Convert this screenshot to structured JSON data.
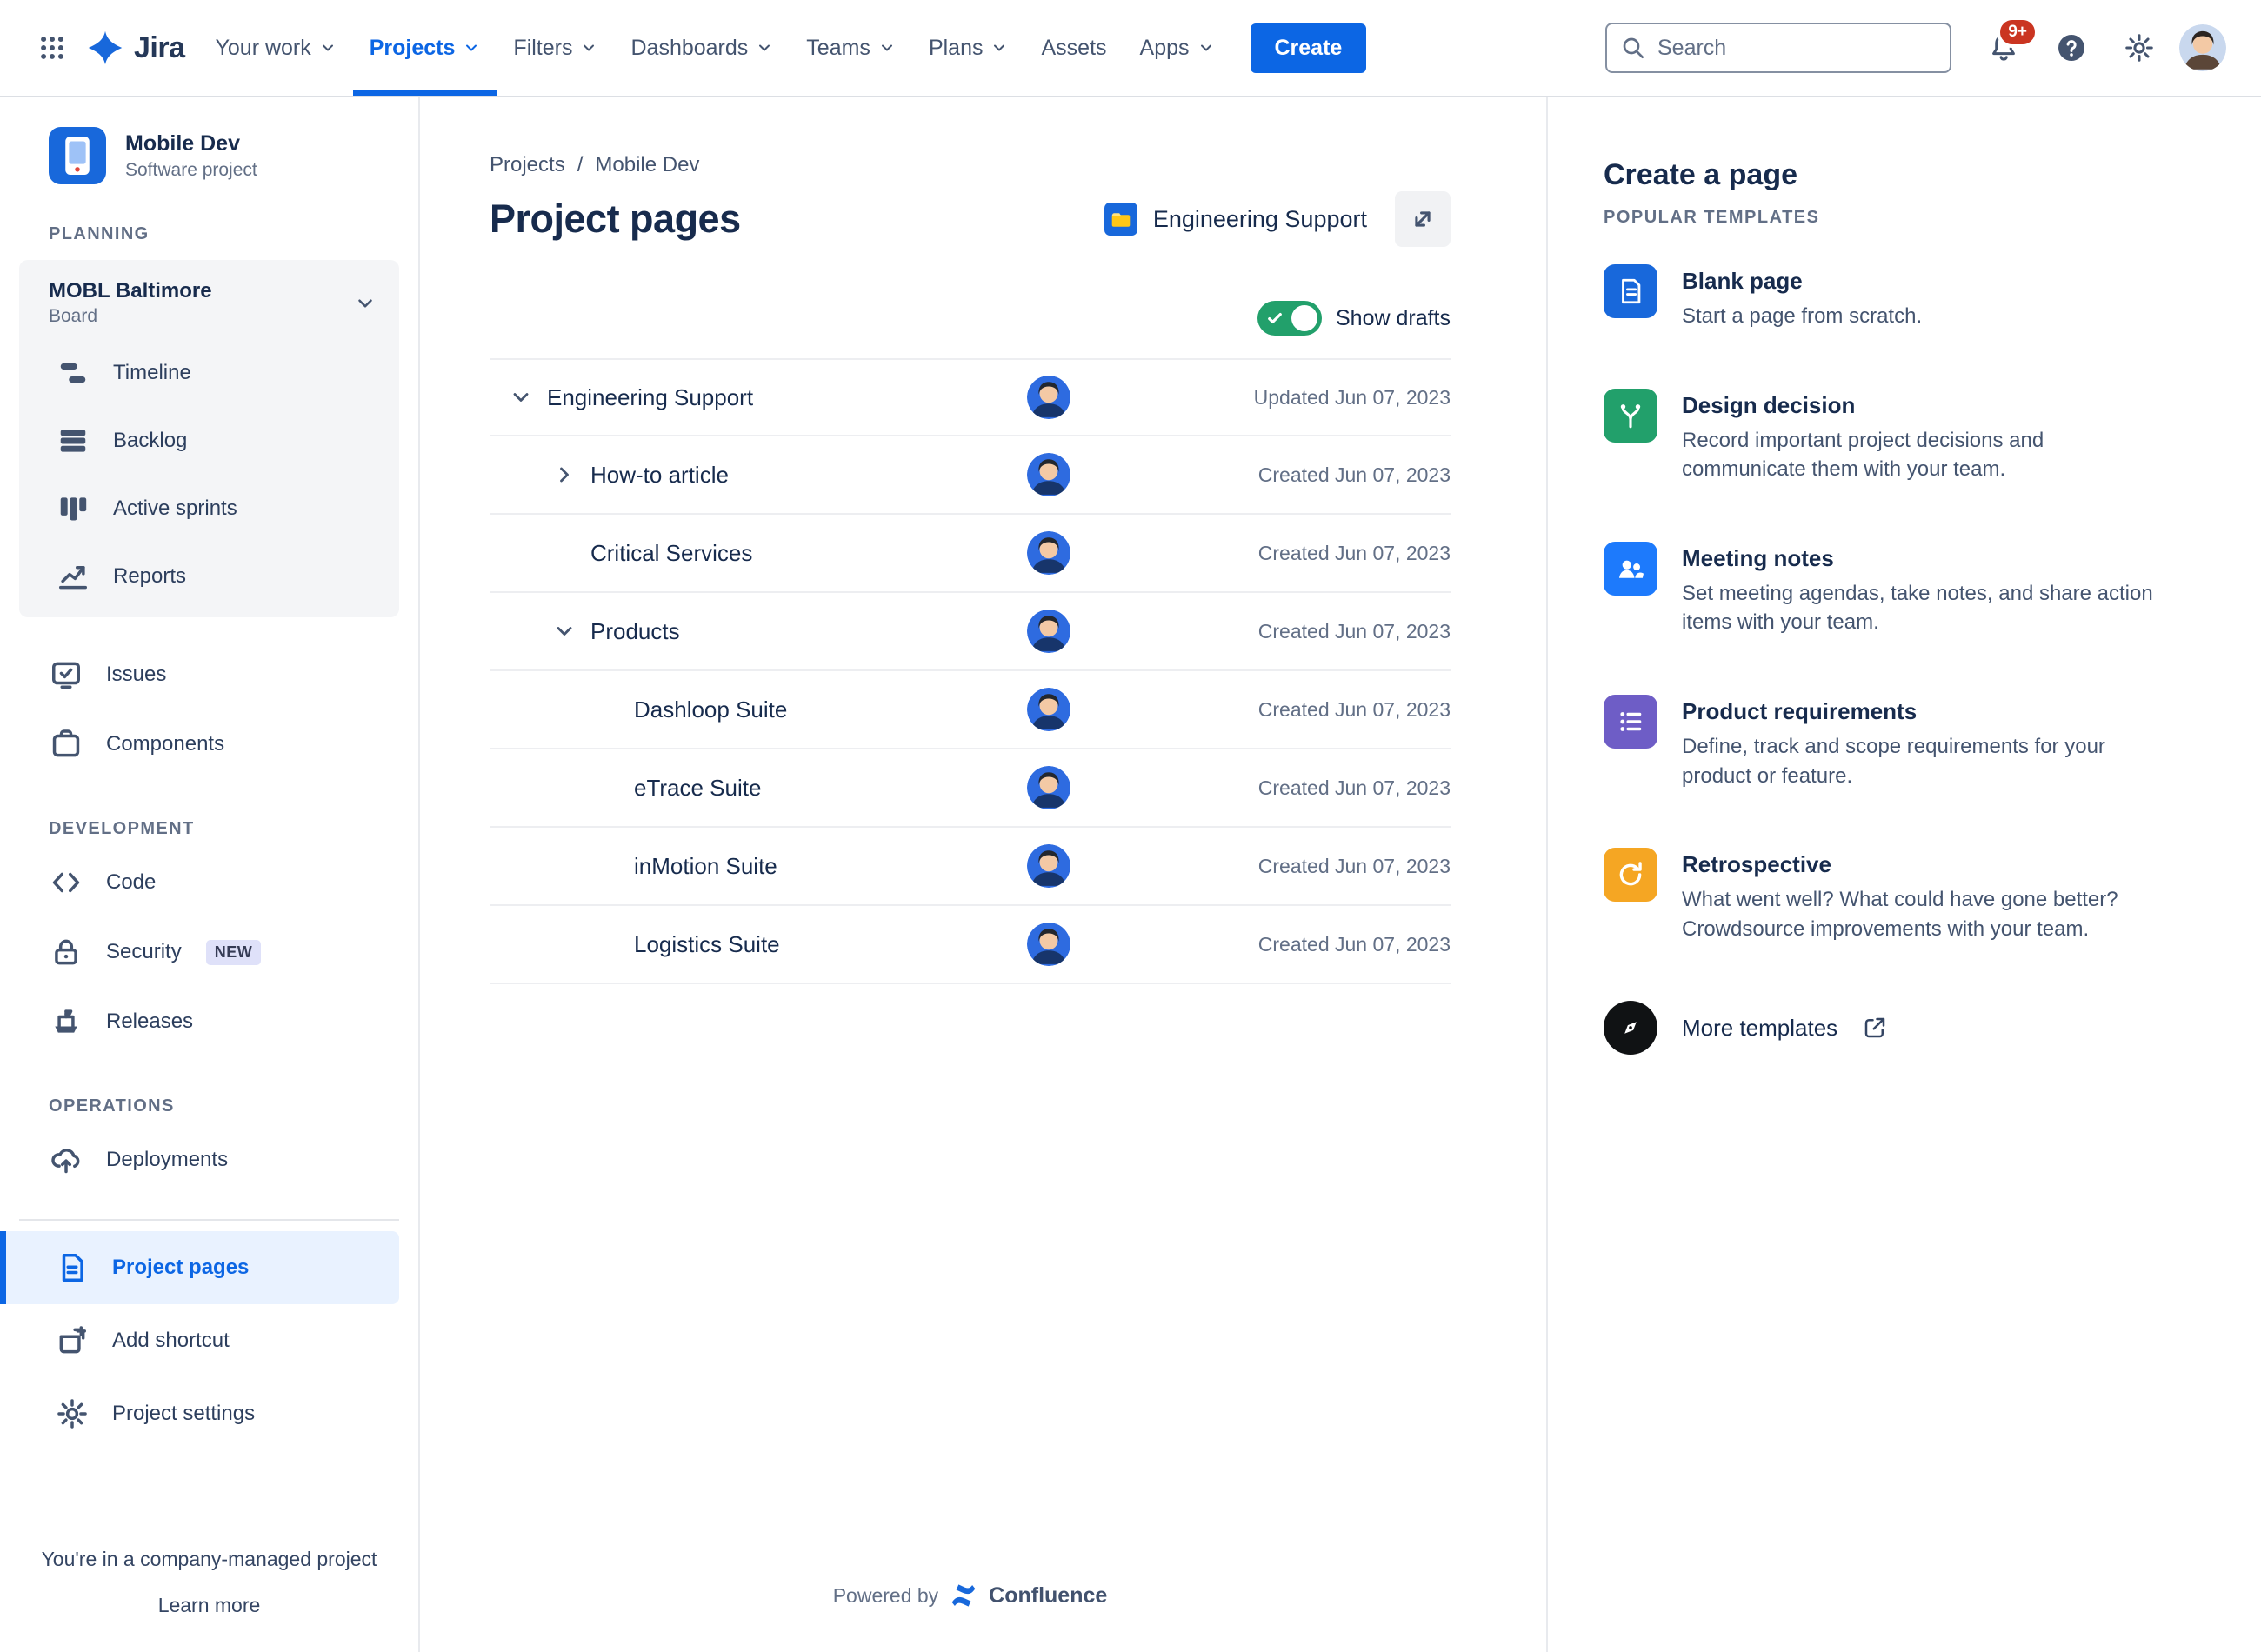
{
  "colors": {
    "accent_blue": "#0C66E4",
    "toggle_on": "#22A06B",
    "badge_red": "#CA3521",
    "selected_bg": "#E9F2FF",
    "more_icon_dark": "#101214"
  },
  "icons": {
    "help_glyph": "?"
  },
  "nav": {
    "brand": "Jira",
    "items": [
      {
        "label": "Your work"
      },
      {
        "label": "Projects"
      },
      {
        "label": "Filters"
      },
      {
        "label": "Dashboards"
      },
      {
        "label": "Teams"
      },
      {
        "label": "Plans"
      },
      {
        "label": "Assets"
      },
      {
        "label": "Apps"
      }
    ],
    "create_label": "Create",
    "search_placeholder": "Search",
    "notifications_badge": "9+"
  },
  "sidebar": {
    "project_name": "Mobile Dev",
    "project_type": "Software project",
    "planning_label": "PLANNING",
    "board_name": "MOBL Baltimore",
    "board_type": "Board",
    "board_items": [
      {
        "label": "Timeline"
      },
      {
        "label": "Backlog"
      },
      {
        "label": "Active sprints"
      },
      {
        "label": "Reports"
      }
    ],
    "items": [
      {
        "label": "Issues"
      },
      {
        "label": "Components"
      }
    ],
    "development_label": "DEVELOPMENT",
    "dev_items": [
      {
        "label": "Code"
      },
      {
        "label": "Security",
        "badge": "NEW"
      },
      {
        "label": "Releases"
      }
    ],
    "operations_label": "OPERATIONS",
    "ops_items": [
      {
        "label": "Deployments"
      }
    ],
    "bottom_items": [
      {
        "label": "Project pages"
      },
      {
        "label": "Add shortcut"
      },
      {
        "label": "Project settings"
      }
    ],
    "footer_note": "You're in a company-managed project",
    "learn_more": "Learn more"
  },
  "main": {
    "breadcrumb": {
      "root": "Projects",
      "separator": "/",
      "current": "Mobile Dev"
    },
    "title": "Project pages",
    "space_name": "Engineering Support",
    "show_drafts_label": "Show drafts",
    "rows": [
      {
        "title": "Engineering Support",
        "meta": "Updated Jun 07, 2023"
      },
      {
        "title": "How-to article",
        "meta": "Created Jun 07, 2023"
      },
      {
        "title": "Critical Services",
        "meta": "Created Jun 07, 2023"
      },
      {
        "title": "Products",
        "meta": "Created Jun 07, 2023"
      },
      {
        "title": "Dashloop Suite",
        "meta": "Created Jun 07, 2023"
      },
      {
        "title": "eTrace Suite",
        "meta": "Created Jun 07, 2023"
      },
      {
        "title": "inMotion Suite",
        "meta": "Created Jun 07, 2023"
      },
      {
        "title": "Logistics Suite",
        "meta": "Created Jun 07, 2023"
      }
    ],
    "powered_by": "Powered by",
    "confluence_label": "Confluence"
  },
  "panel": {
    "title": "Create a page",
    "subtitle": "POPULAR TEMPLATES",
    "templates": [
      {
        "name": "Blank page",
        "desc": "Start a page from scratch.",
        "color": "#1868DB"
      },
      {
        "name": "Design decision",
        "desc": "Record important project decisions and communicate them with your team.",
        "color": "#22A06B"
      },
      {
        "name": "Meeting notes",
        "desc": "Set meeting agendas, take notes, and share action items with your team.",
        "color": "#1D7AFC"
      },
      {
        "name": "Product requirements",
        "desc": "Define, track and scope requirements for your product or feature.",
        "color": "#6E5DC6"
      },
      {
        "name": "Retrospective",
        "desc": "What went well? What could have gone better? Crowdsource improvements with your team.",
        "color": "#F5A623"
      }
    ],
    "more_label": "More templates"
  }
}
